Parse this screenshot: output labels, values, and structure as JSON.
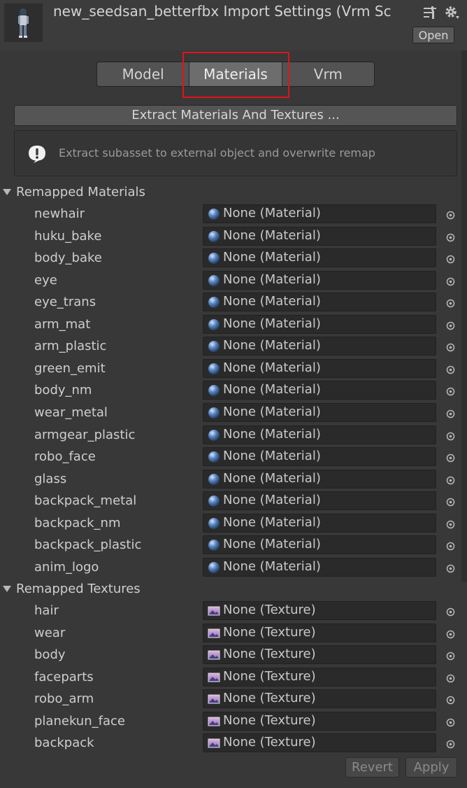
{
  "header": {
    "title": "new_seedsan_betterfbx Import Settings (Vrm Sc",
    "open_label": "Open",
    "thumbnail_icon": "avatar-model-thumbnail",
    "layout_icon": "preset-sliders-icon",
    "settings_icon": "gear-icon"
  },
  "tabs": [
    {
      "label": "Model",
      "active": false
    },
    {
      "label": "Materials",
      "active": true
    },
    {
      "label": "Vrm",
      "active": false
    }
  ],
  "extract_button_label": "Extract Materials And Textures ...",
  "help_text": "Extract subasset to external object and overwrite remap",
  "materials": {
    "header": "Remapped Materials",
    "items": [
      {
        "name": "newhair",
        "value": "None (Material)"
      },
      {
        "name": "huku_bake",
        "value": "None (Material)"
      },
      {
        "name": "body_bake",
        "value": "None (Material)"
      },
      {
        "name": "eye",
        "value": "None (Material)"
      },
      {
        "name": "eye_trans",
        "value": "None (Material)"
      },
      {
        "name": "arm_mat",
        "value": "None (Material)"
      },
      {
        "name": "arm_plastic",
        "value": "None (Material)"
      },
      {
        "name": "green_emit",
        "value": "None (Material)"
      },
      {
        "name": "body_nm",
        "value": "None (Material)"
      },
      {
        "name": "wear_metal",
        "value": "None (Material)"
      },
      {
        "name": "armgear_plastic",
        "value": "None (Material)"
      },
      {
        "name": "robo_face",
        "value": "None (Material)"
      },
      {
        "name": "glass",
        "value": "None (Material)"
      },
      {
        "name": "backpack_metal",
        "value": "None (Material)"
      },
      {
        "name": "backpack_nm",
        "value": "None (Material)"
      },
      {
        "name": "backpack_plastic",
        "value": "None (Material)"
      },
      {
        "name": "anim_logo",
        "value": "None (Material)"
      }
    ]
  },
  "textures": {
    "header": "Remapped Textures",
    "items": [
      {
        "name": "hair",
        "value": "None (Texture)"
      },
      {
        "name": "wear",
        "value": "None (Texture)"
      },
      {
        "name": "body",
        "value": "None (Texture)"
      },
      {
        "name": "faceparts",
        "value": "None (Texture)"
      },
      {
        "name": "robo_arm",
        "value": "None (Texture)"
      },
      {
        "name": "planekun_face",
        "value": "None (Texture)"
      },
      {
        "name": "backpack",
        "value": "None (Texture)"
      }
    ]
  },
  "footer": {
    "revert_label": "Revert",
    "apply_label": "Apply"
  },
  "colors": {
    "background": "#383838",
    "highlight": "#e0141c",
    "material_sphere": "#5a86c0",
    "texture_swatch": "#b58ac8"
  }
}
